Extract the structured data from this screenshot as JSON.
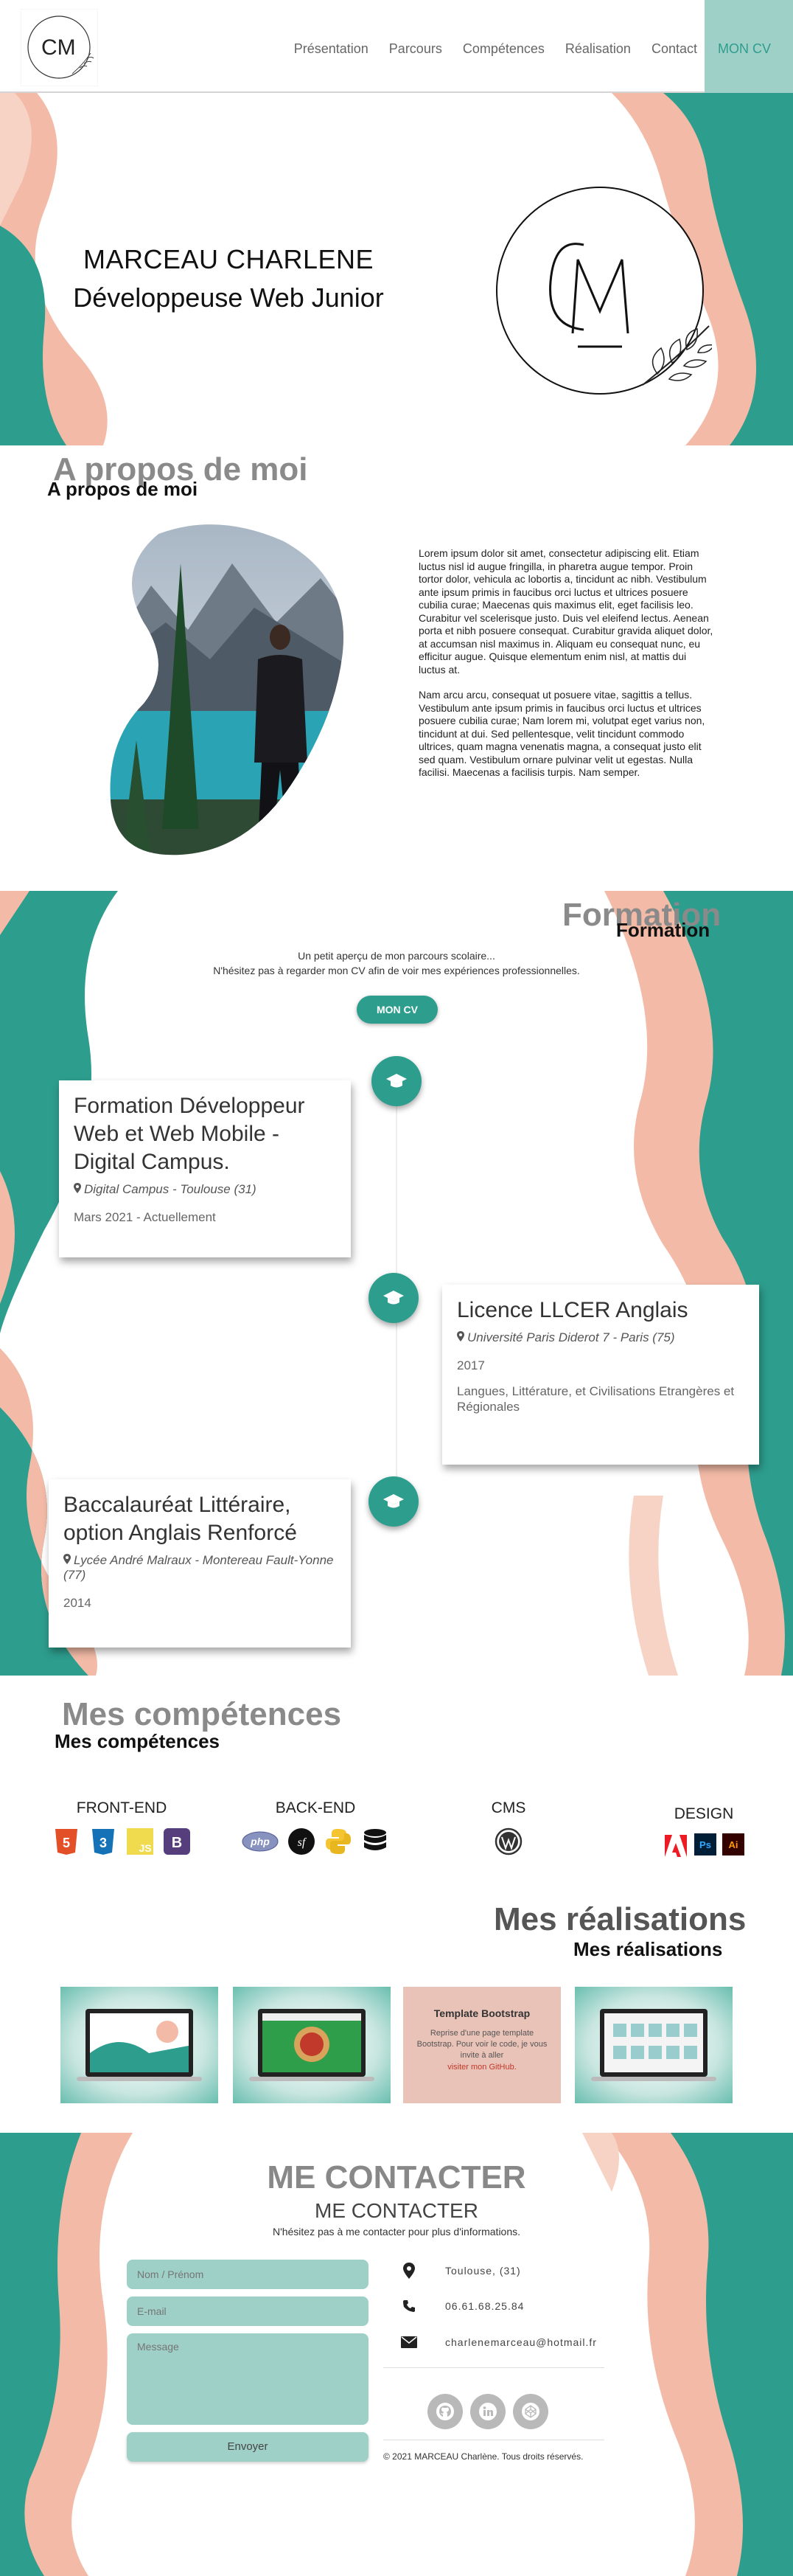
{
  "colors": {
    "teal": "#2d9d8d",
    "teal_light": "#9fd0c8",
    "salmon": "#f3bba7",
    "grey_title": "#8a8a8a"
  },
  "nav": {
    "logo_text": "CM",
    "links": [
      "Présentation",
      "Parcours",
      "Compétences",
      "Réalisation",
      "Contact"
    ],
    "cv": "MON CV"
  },
  "hero": {
    "name": "MARCEAU CHARLENE",
    "subtitle": "Développeuse Web Junior"
  },
  "about": {
    "title": "A propos de moi",
    "p1": "Lorem ipsum dolor sit amet, consectetur adipiscing elit. Etiam luctus nisl id augue fringilla, in pharetra augue tempor. Proin tortor dolor, vehicula ac lobortis a, tincidunt ac nibh. Vestibulum ante ipsum primis in faucibus orci luctus et ultrices posuere cubilia curae; Maecenas quis maximus elit, eget facilisis leo. Curabitur vel scelerisque justo. Duis vel eleifend lectus. Aenean porta et nibh posuere consequat. Curabitur gravida aliquet dolor, at accumsan nisl maximus in. Aliquam eu consequat nunc, eu efficitur augue. Quisque elementum enim nisl, at mattis dui luctus at.",
    "p2": "Nam arcu arcu, consequat ut posuere vitae, sagittis a tellus. Vestibulum ante ipsum primis in faucibus orci luctus et ultrices posuere cubilia curae; Nam lorem mi, volutpat eget varius non, tincidunt at dui. Sed pellentesque, velit tincidunt commodo ultrices, quam magna venenatis magna, a consequat justo elit sed quam. Vestibulum ornare pulvinar velit ut egestas. Nulla facilisi. Maecenas a facilisis turpis. Nam semper."
  },
  "formation": {
    "title": "Formation",
    "intro1": "Un petit aperçu de mon parcours scolaire...",
    "intro2": "N'hésitez pas à regarder mon CV afin de voir mes expériences professionnelles.",
    "cv_button": "MON CV",
    "items": [
      {
        "title": "Formation Développeur Web et Web Mobile - Digital Campus.",
        "place": "Digital Campus - Toulouse (31)",
        "date": "Mars 2021 - Actuellement",
        "desc": ""
      },
      {
        "title": "Licence LLCER Anglais",
        "place": "Université Paris Diderot 7 - Paris (75)",
        "date": "2017",
        "desc": "Langues, Littérature, et Civilisations Etrangères et Régionales"
      },
      {
        "title": "Baccalauréat Littéraire, option Anglais Renforcé",
        "place": "Lycée André Malraux - Montereau Fault-Yonne (77)",
        "date": "2014",
        "desc": ""
      }
    ]
  },
  "skills": {
    "title": "Mes compétences",
    "groups": [
      {
        "label": "FRONT-END",
        "icons": [
          "html5-icon",
          "css3-icon",
          "js-icon",
          "bootstrap-icon"
        ]
      },
      {
        "label": "BACK-END",
        "icons": [
          "php-icon",
          "symfony-icon",
          "python-icon",
          "database-icon"
        ]
      },
      {
        "label": "CMS",
        "icons": [
          "wordpress-icon"
        ]
      },
      {
        "label": "DESIGN",
        "icons": [
          "adobe-icon",
          "photoshop-icon",
          "illustrator-icon"
        ]
      }
    ],
    "badges": {
      "html5": "5",
      "css3": "3",
      "js": "JS",
      "bootstrap": "B",
      "php": "php",
      "symfony": "sf",
      "photoshop": "Ps",
      "illustrator": "Ai"
    }
  },
  "projects": {
    "title": "Mes réalisations",
    "template_title": "Template Bootstrap",
    "template_desc": "Reprise d'une page template Bootstrap. Pour voir le code, je vous invite à aller",
    "template_link": "visiter mon GitHub."
  },
  "contact": {
    "title": "ME CONTACTER",
    "intro": "N'hésitez pas à me contacter pour plus d'informations.",
    "name_placeholder": "Nom / Prénom",
    "email_placeholder": "E-mail",
    "message_placeholder": "Message",
    "send": "Envoyer",
    "location": "Toulouse, (31)",
    "phone": "06.61.68.25.84",
    "email": "charlenemarceau@hotmail.fr",
    "copyright": "© 2021 MARCEAU Charlène. Tous droits réservés."
  }
}
